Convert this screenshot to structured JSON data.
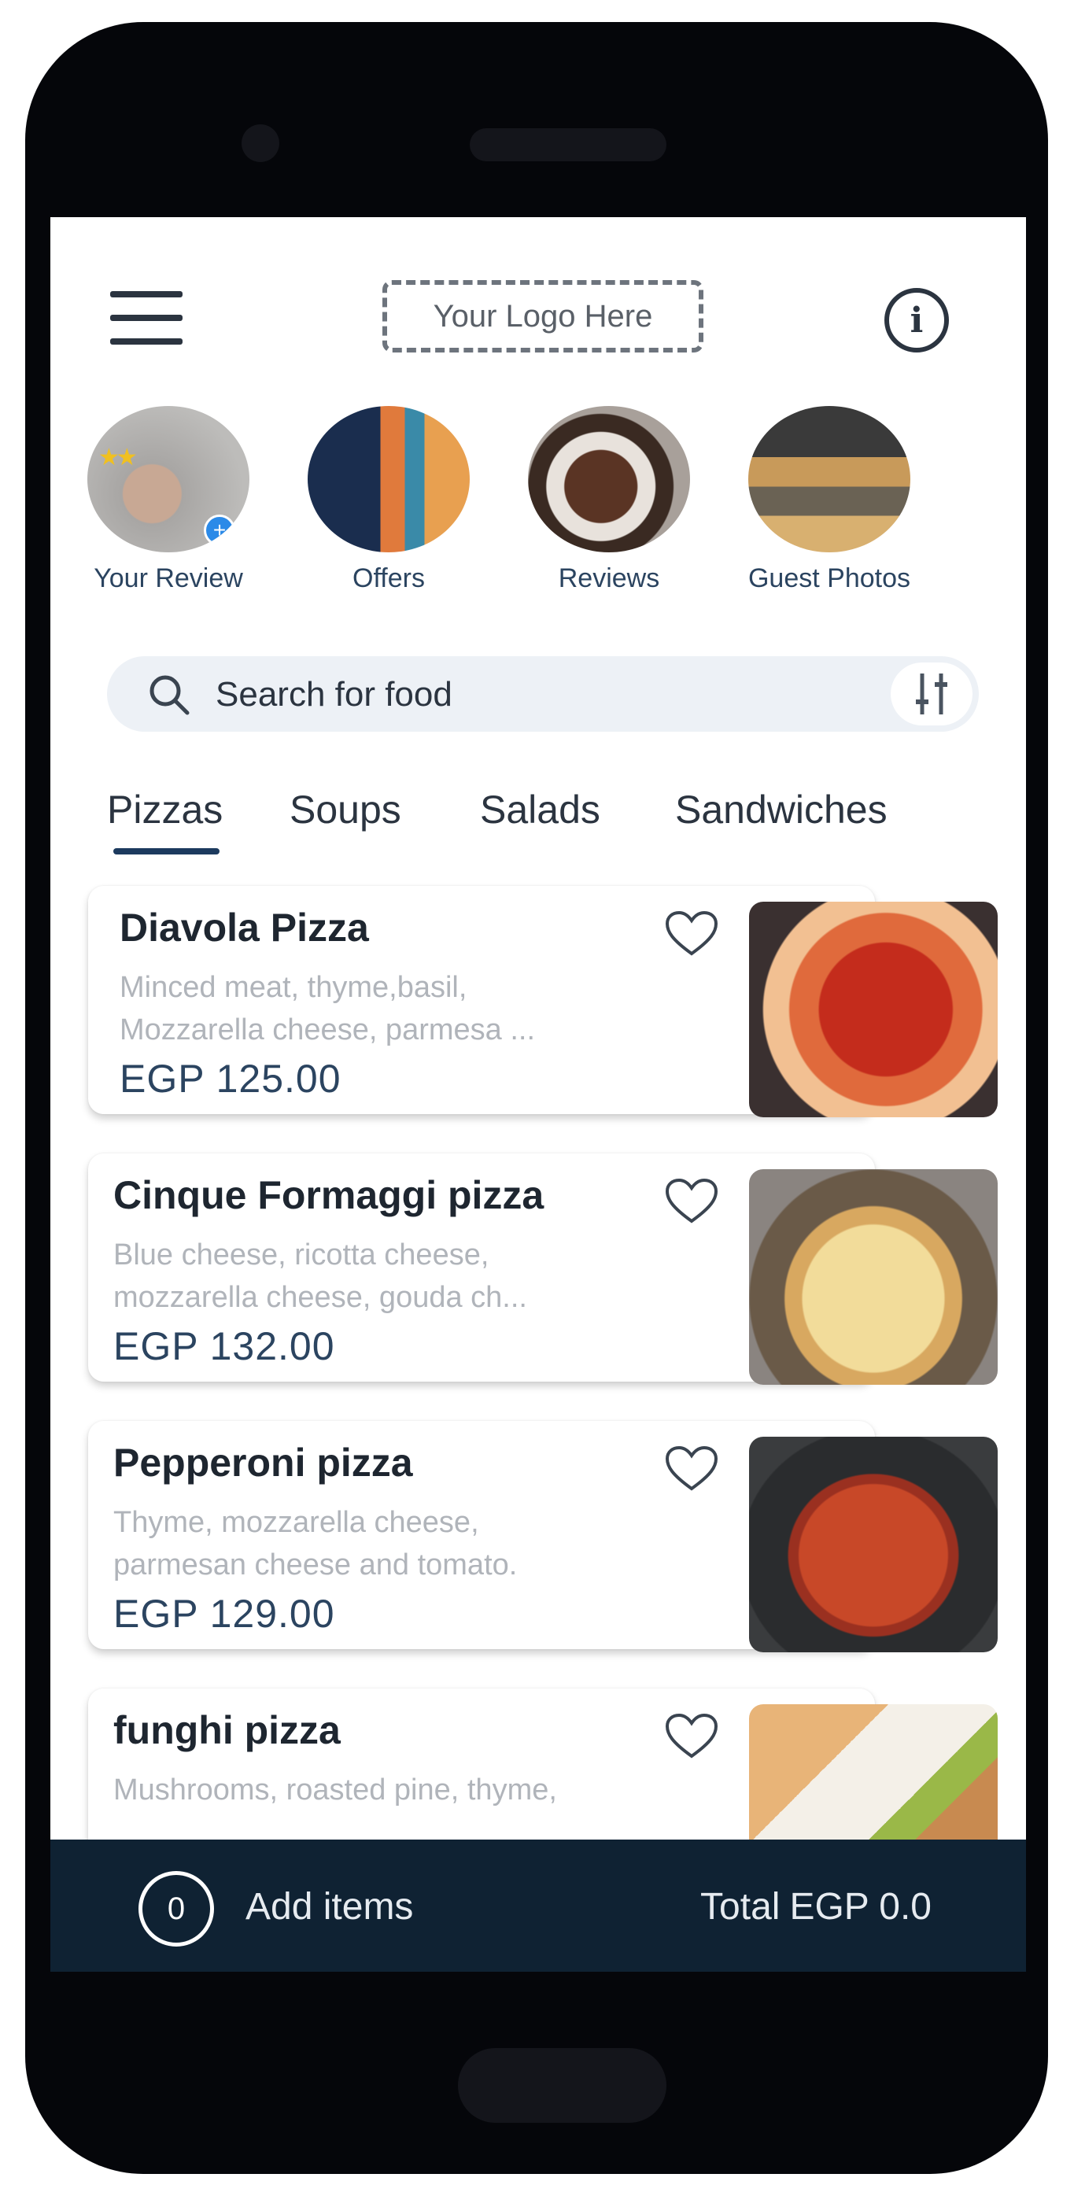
{
  "header": {
    "logo_text": "Your Logo Here",
    "info_glyph": "i",
    "menu_icon": "hamburger-menu-icon"
  },
  "stories": [
    {
      "label": "Your Review"
    },
    {
      "label": "Offers"
    },
    {
      "label": "Reviews"
    },
    {
      "label": "Guest Photos"
    }
  ],
  "search": {
    "placeholder": "Search for food"
  },
  "tabs": [
    {
      "label": "Pizzas",
      "active": true
    },
    {
      "label": "Soups",
      "active": false
    },
    {
      "label": "Salads",
      "active": false
    },
    {
      "label": "Sandwiches",
      "active": false
    }
  ],
  "items": [
    {
      "name": "Diavola Pizza",
      "desc_line1": "Minced meat, thyme,basil,",
      "desc_line2": "Mozzarella cheese, parmesa ...",
      "price": "EGP 125.00"
    },
    {
      "name": "Cinque Formaggi pizza",
      "desc_line1": "Blue cheese, ricotta cheese,",
      "desc_line2": "mozzarella cheese, gouda ch...",
      "price": "EGP 132.00"
    },
    {
      "name": "Pepperoni pizza",
      "desc_line1": "Thyme, mozzarella cheese,",
      "desc_line2": "parmesan cheese and tomato.",
      "price": "EGP 129.00"
    },
    {
      "name": "funghi pizza",
      "desc_line1": "Mushrooms, roasted pine, thyme,",
      "desc_line2": "",
      "price": ""
    }
  ],
  "cart": {
    "count": "0",
    "add_label": "Add items",
    "total_label": "Total",
    "total_value": "EGP 0.0"
  },
  "colors": {
    "accent": "#1c3a5e",
    "bar": "#0f2233",
    "search_bg": "#edf1f6"
  }
}
